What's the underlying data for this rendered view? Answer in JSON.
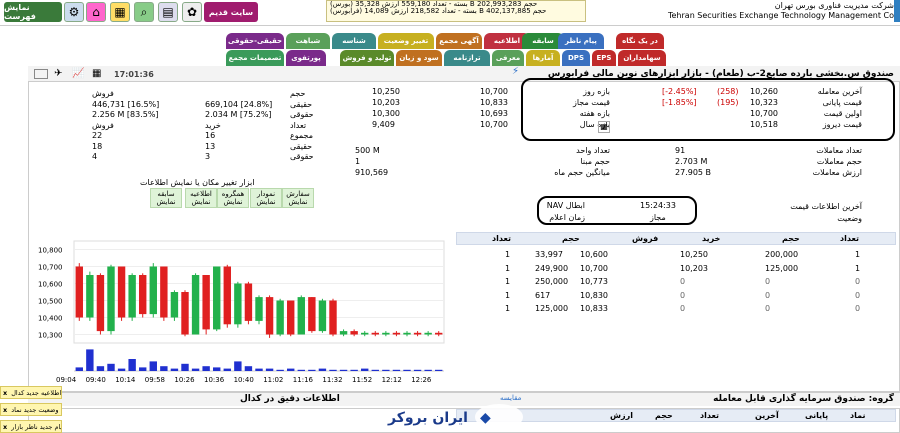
{
  "top": {
    "buttons": [
      {
        "label": "نمایش فهرست",
        "color": "#3a7a3a"
      },
      {
        "label": "سایت قدیم",
        "color": "#a01c6e"
      }
    ],
    "ticker_lines": [
      "(بورس) بسته - تعداد 559,180 ارزش 35,328 B حجم 202,993,283",
      "(فرابورس) بسته - تعداد 218,582 ارزش 14,089 B حجم 402,137,885"
    ],
    "corp_fa": "شرکت مدیریت فناوری بورس تهران",
    "corp_en": "Tehran Securities Exchange Technology Management Co"
  },
  "tabs_row1": [
    {
      "label": "حقیقی-حقوقی",
      "color": "#7a2a8a"
    },
    {
      "label": "شباهت",
      "color": "#5aa05a"
    },
    {
      "label": "شناسه",
      "color": "#3a8a8a"
    },
    {
      "label": "تغییر وضعیت",
      "color": "#c7b020"
    },
    {
      "label": "آگهی مجمع",
      "color": "#c07020"
    },
    {
      "label": "اطلاعیه",
      "color": "#c03040"
    },
    {
      "label": "سابقه",
      "color": "#2a8a3a"
    },
    {
      "label": "پیام ناظر",
      "color": "#3a70c0"
    },
    {
      "label": "در یک نگاه",
      "color": "#c02a2a"
    }
  ],
  "tabs_row2": [
    {
      "label": "تصمیمات مجمع",
      "color": "#3a9a5a"
    },
    {
      "label": "پورتفوی",
      "color": "#7a2a8a"
    },
    {
      "label": "تولید و فروش",
      "color": "#5a8a2a"
    },
    {
      "label": "سود و زیان",
      "color": "#c07020"
    },
    {
      "label": "ترازنامه",
      "color": "#3a8a8a"
    },
    {
      "label": "معرفی",
      "color": "#5aa05a"
    },
    {
      "label": "آمارها",
      "color": "#c7b020"
    },
    {
      "label": "DPS",
      "color": "#3a70c0"
    },
    {
      "label": "EPS",
      "color": "#c02a2a"
    },
    {
      "label": "سهامداران",
      "color": "#c02a2a"
    }
  ],
  "header": {
    "time": "17:01:36",
    "title": "صندوق س.بخشی بارده صایع2-ب (طعام) - بازار ابزارهای نوین مالی فرابورس"
  },
  "price": {
    "rows": [
      {
        "label": "آخرین معامله",
        "value": "10,260",
        "chg": "(258)",
        "pct": "[-2.45%]"
      },
      {
        "label": "قیمت پایانی",
        "value": "10,323",
        "chg": "(195)",
        "pct": "[-1.85%]"
      },
      {
        "label": "اولین قیمت",
        "value": "10,700",
        "chg": "",
        "pct": ""
      },
      {
        "label": "قیمت دیروز",
        "value": "10,518",
        "chg": "",
        "pct": ""
      }
    ],
    "ranges": [
      {
        "label": "بازه روز",
        "min": "10,250",
        "max": "10,700"
      },
      {
        "label": "قیمت مجاز",
        "min": "10,203",
        "max": "10,833"
      },
      {
        "label": "بازه هفته",
        "min": "10,300",
        "max": "10,693"
      },
      {
        "label": "بازه سال",
        "min": "9,409",
        "max": "10,700"
      }
    ]
  },
  "stats": [
    {
      "label": "تعداد معاملات",
      "value": "91"
    },
    {
      "label": "حجم معاملات",
      "value": "2.703 M"
    },
    {
      "label": "ارزش معاملات",
      "value": "27.905 B"
    }
  ],
  "stats2": [
    {
      "label": "تعداد واحد",
      "value": "500 M"
    },
    {
      "label": "حجم مبنا",
      "value": "1"
    },
    {
      "label": "میانگین حجم ماه",
      "value": "910,569"
    }
  ],
  "nav": {
    "label1": "آخرین اطلاعات قیمت",
    "label2": "وضعیت",
    "nav_label": "NAV ابطال",
    "nav_value": "15:24:33",
    "time_label": "زمان اعلام",
    "time_value": "مجاز"
  },
  "client": {
    "headers": [
      "",
      "خرید",
      "فروش"
    ],
    "rows": [
      {
        "label": "حجم",
        "buy": "",
        "sell": "فروش"
      },
      {
        "label": "حقیقی",
        "buy": "669,104 [24.8%]",
        "sell": "446,731 [16.5%]"
      },
      {
        "label": "حقوقی",
        "buy": "2.034 M [75.2%]",
        "sell": "2.256 M [83.5%]"
      },
      {
        "label": "تعداد",
        "buy": "خرید",
        "sell": "فروش"
      },
      {
        "label": "مجموع",
        "buy": "16",
        "sell": "22"
      },
      {
        "label": "حقیقی",
        "buy": "13",
        "sell": "18"
      },
      {
        "label": "حقوقی",
        "buy": "3",
        "sell": "4"
      }
    ]
  },
  "tools": {
    "caption": "ابزار تغییر مکان یا نمایش اطلاعات",
    "buttons": [
      {
        "l1": "سفارش",
        "l2": "نمایش"
      },
      {
        "l1": "نمودار",
        "l2": "نمایش"
      },
      {
        "l1": "همگروه",
        "l2": "نمایش"
      },
      {
        "l1": "اطلاعیه",
        "l2": "نمایش"
      },
      {
        "l1": "سابقه",
        "l2": "نمایش"
      }
    ]
  },
  "orderbook": {
    "headers": [
      "تعداد",
      "حجم",
      "خرید",
      "فروش",
      "حجم",
      "تعداد"
    ],
    "rows": [
      [
        "1",
        "200,000",
        "10,250",
        "10,600",
        "33,997",
        "1"
      ],
      [
        "1",
        "125,000",
        "10,203",
        "10,700",
        "249,900",
        "1"
      ],
      [
        "0",
        "0",
        "0",
        "10,773",
        "250,000",
        "1"
      ],
      [
        "0",
        "0",
        "0",
        "10,830",
        "617",
        "1"
      ],
      [
        "0",
        "0",
        "0",
        "10,833",
        "125,000",
        "1"
      ]
    ]
  },
  "chart_data": {
    "type": "candlestick",
    "yticks": [
      "10,800",
      "10,700",
      "10,600",
      "10,500",
      "10,400",
      "10,300"
    ],
    "ylim": [
      10250,
      10850
    ],
    "xticks": [
      "09:04",
      "09:40",
      "10:14",
      "09:58",
      "10:26",
      "10:36",
      "10:40",
      "11:02",
      "11:16",
      "11:32",
      "11:52",
      "12:12",
      "12:26"
    ],
    "candles": [
      {
        "o": 10700,
        "c": 10400,
        "h": 10720,
        "l": 10380
      },
      {
        "o": 10400,
        "c": 10650,
        "h": 10670,
        "l": 10380
      },
      {
        "o": 10650,
        "c": 10320,
        "h": 10660,
        "l": 10300
      },
      {
        "o": 10320,
        "c": 10700,
        "h": 10710,
        "l": 10300
      },
      {
        "o": 10700,
        "c": 10400,
        "h": 10700,
        "l": 10380
      },
      {
        "o": 10400,
        "c": 10650,
        "h": 10660,
        "l": 10380
      },
      {
        "o": 10650,
        "c": 10420,
        "h": 10660,
        "l": 10400
      },
      {
        "o": 10420,
        "c": 10700,
        "h": 10720,
        "l": 10400
      },
      {
        "o": 10700,
        "c": 10400,
        "h": 10700,
        "l": 10380
      },
      {
        "o": 10400,
        "c": 10550,
        "h": 10560,
        "l": 10380
      },
      {
        "o": 10550,
        "c": 10300,
        "h": 10560,
        "l": 10290
      },
      {
        "o": 10300,
        "c": 10650,
        "h": 10660,
        "l": 10300
      },
      {
        "o": 10650,
        "c": 10330,
        "h": 10650,
        "l": 10300
      },
      {
        "o": 10330,
        "c": 10700,
        "h": 10700,
        "l": 10320
      },
      {
        "o": 10700,
        "c": 10360,
        "h": 10710,
        "l": 10340
      },
      {
        "o": 10360,
        "c": 10600,
        "h": 10610,
        "l": 10340
      },
      {
        "o": 10600,
        "c": 10380,
        "h": 10610,
        "l": 10360
      },
      {
        "o": 10380,
        "c": 10520,
        "h": 10530,
        "l": 10360
      },
      {
        "o": 10520,
        "c": 10300,
        "h": 10530,
        "l": 10280
      },
      {
        "o": 10300,
        "c": 10500,
        "h": 10510,
        "l": 10290
      },
      {
        "o": 10500,
        "c": 10300,
        "h": 10500,
        "l": 10290
      },
      {
        "o": 10300,
        "c": 10520,
        "h": 10530,
        "l": 10300
      },
      {
        "o": 10520,
        "c": 10320,
        "h": 10520,
        "l": 10310
      },
      {
        "o": 10320,
        "c": 10500,
        "h": 10510,
        "l": 10310
      },
      {
        "o": 10500,
        "c": 10300,
        "h": 10510,
        "l": 10290
      },
      {
        "o": 10300,
        "c": 10320,
        "h": 10330,
        "l": 10290
      },
      {
        "o": 10320,
        "c": 10300,
        "h": 10330,
        "l": 10290
      },
      {
        "o": 10300,
        "c": 10310,
        "h": 10320,
        "l": 10290
      },
      {
        "o": 10310,
        "c": 10300,
        "h": 10320,
        "l": 10290
      },
      {
        "o": 10300,
        "c": 10310,
        "h": 10320,
        "l": 10290
      },
      {
        "o": 10310,
        "c": 10300,
        "h": 10320,
        "l": 10290
      },
      {
        "o": 10300,
        "c": 10310,
        "h": 10320,
        "l": 10290
      },
      {
        "o": 10310,
        "c": 10300,
        "h": 10320,
        "l": 10290
      },
      {
        "o": 10300,
        "c": 10310,
        "h": 10320,
        "l": 10290
      },
      {
        "o": 10310,
        "c": 10300,
        "h": 10320,
        "l": 10290
      }
    ],
    "volumes": [
      0.15,
      0.9,
      0.2,
      0.3,
      0.1,
      0.5,
      0.15,
      0.4,
      0.2,
      0.1,
      0.3,
      0.1,
      0.2,
      0.15,
      0.1,
      0.4,
      0.2,
      0.1,
      0.1,
      0.05,
      0.1,
      0.05,
      0.05,
      0.1,
      0.05,
      0.05,
      0.05,
      0.1,
      0.05,
      0.05,
      0.05,
      0.05,
      0.05,
      0.05,
      0.05
    ]
  },
  "bottom": {
    "group": "گروه: صندوق سرمایه گذاری قابل معامله",
    "mid": "اطلاعات دقیق در کدال",
    "link": "مقایسه",
    "cols": [
      "نماد",
      "پایانی",
      "آخرین",
      "تعداد",
      "حجم",
      "ارزش"
    ]
  },
  "notifs": [
    "اطلاعیه جدید کدال",
    "وضعیت جدید نماد",
    "پیام جدید ناظر بازار"
  ],
  "brand": "ایران بروکر"
}
